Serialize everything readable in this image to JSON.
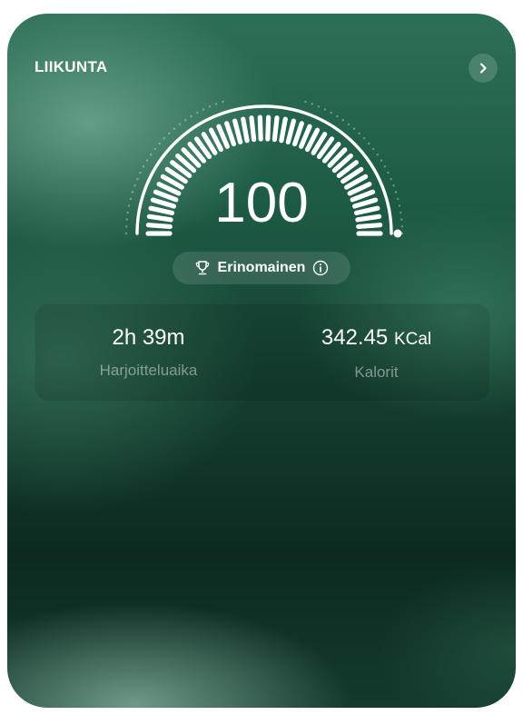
{
  "card": {
    "title": "LIIKUNTA",
    "next_icon": "chevron-right-icon"
  },
  "gauge": {
    "score": "100",
    "max": 100,
    "accent_color": "#ffffff"
  },
  "rating": {
    "icon": "trophy-icon",
    "label": "Erinomainen",
    "info_icon": "info-icon"
  },
  "stats": {
    "duration": {
      "value": "2h 39m",
      "label": "Harjoitteluaika"
    },
    "calories": {
      "value": "342.45",
      "unit": "KCal",
      "label": "Kalorit"
    }
  }
}
